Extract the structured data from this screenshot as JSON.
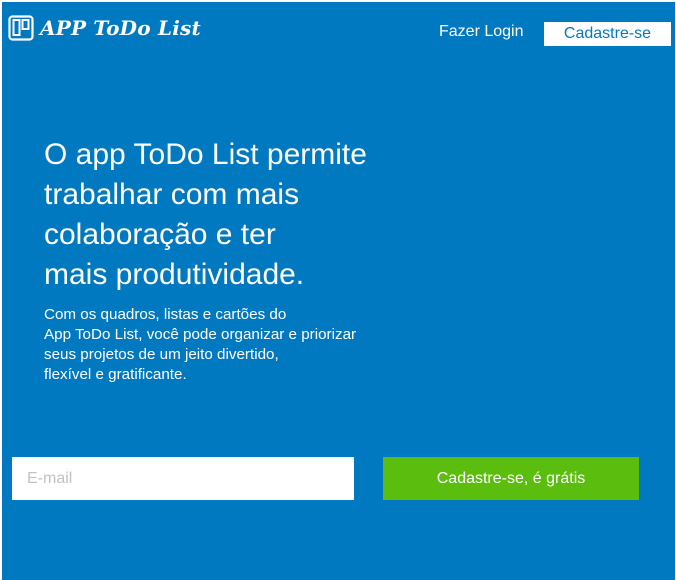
{
  "header": {
    "logo_text": "APP ToDo List",
    "logo_icon": "board-icon",
    "login_label": "Fazer Login",
    "signup_label": "Cadastre-se"
  },
  "hero": {
    "headline_lines": [
      "O app ToDo List permite",
      "trabalhar com mais",
      "colaboração e ter",
      "mais produtividade."
    ],
    "subtext_lines": [
      "Com os quadros, listas e cartões do",
      "App ToDo List, você pode organizar e priorizar",
      "seus projetos de um jeito divertido,",
      "flexível e gratificante."
    ]
  },
  "form": {
    "email_placeholder": "E-mail",
    "email_value": "",
    "cta_label": "Cadastre-se, é grátis"
  },
  "colors": {
    "background": "#0179c1",
    "cta": "#5bbd0d",
    "text": "#ffffff"
  }
}
